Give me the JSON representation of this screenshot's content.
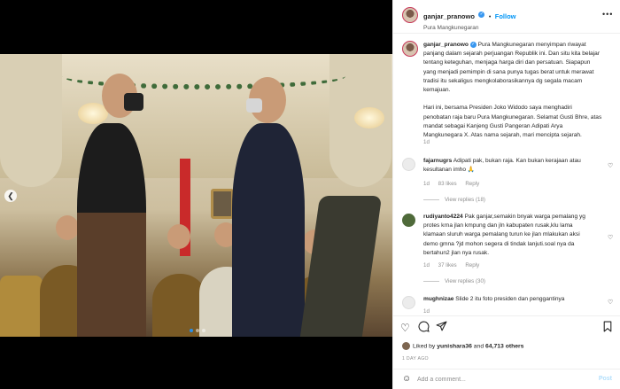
{
  "post": {
    "username": "ganjar_pranowo",
    "location": "Pura Mangkunegaran",
    "follow_label": "Follow",
    "more_icon": "more-icon",
    "caption_lines": [
      "Pura Mangkunegaran menyimpan riwayat",
      "panjang dalam sejarah perjuangan Republik ini. Dan situ kita belajar",
      "tentang keteguhan, menjaga harga diri dan persatuan. Siapapun",
      "yang menjadi pemimpin di sana punya tugas berat untuk merawat",
      "tradisi itu sekaligus mengkolaborasikannya dg segala macam",
      "kemajuan.",
      "",
      "Hari ini, bersama Presiden Joko Widodo saya menghadiri",
      "penobatan raja baru Pura Mangkunegaran. Selamat Gusti Bhre, atas",
      "mandat sebagai Kanjeng Gusti Pangeran Adipati Arya",
      "Mangkunegara X. Atas nama sejarah, mari mencipta sejarah."
    ],
    "caption_time": "1d"
  },
  "comments": [
    {
      "username": "fajarnugrs",
      "text_lines": [
        "Adipati pak, bukan raja. Kan bukan kerajaan atau",
        "kesultanan imho 🙏"
      ],
      "time": "1d",
      "likes": "83 likes",
      "reply_label": "Reply",
      "view_replies": "View replies (18)",
      "avatar_color": "#e6e6e6"
    },
    {
      "username": "rudiyanto4224",
      "text_lines": [
        "Pak ganjar,semakin bnyak warga pemalang yg",
        "protes krna jlan kmpung dan jln kabupaten rusak,klu lama",
        "klamaan sluruh warga pemalang turun ke jlan mlakukan aksi",
        "demo gmna ?jd mohon segera di tindak lanjuti.soal nya da",
        "bertahun2 jlan nya rusak."
      ],
      "time": "1d",
      "likes": "37 likes",
      "reply_label": "Reply",
      "view_replies": "View replies (30)",
      "avatar_color": "#4f6a3a"
    },
    {
      "username": "mughnizae",
      "text_lines": [
        "Slide 2 itu foto presiden dan penggantinya"
      ],
      "time": "1d",
      "likes": "",
      "reply_label": "",
      "view_replies": "",
      "avatar_color": "#e6e6e6"
    }
  ],
  "actions": {
    "like_icon": "heart-icon",
    "comment_icon": "comment-icon",
    "share_icon": "share-icon",
    "save_icon": "bookmark-icon",
    "liked_by_prefix": "Liked by",
    "liked_by_user": "yunishara36",
    "liked_by_and": "and",
    "liked_by_count": "64,713 others",
    "time_ago": "1 DAY AGO"
  },
  "add_comment": {
    "placeholder": "Add a comment...",
    "post_label": "Post",
    "emoji_icon": "smiley-icon"
  },
  "media": {
    "prev_icon": "chevron-left-icon",
    "slide_count": 3,
    "active_slide": 1,
    "colors": {
      "accent": "#0095f6",
      "dot_active": "#2a8fe6"
    }
  }
}
